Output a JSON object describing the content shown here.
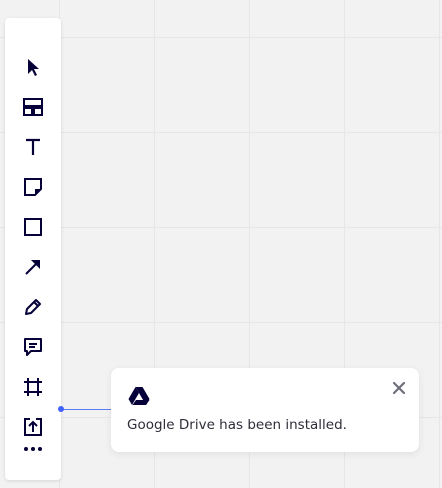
{
  "toolbar": {
    "tools": [
      {
        "name": "select",
        "icon": "cursor-icon"
      },
      {
        "name": "templates",
        "icon": "templates-icon"
      },
      {
        "name": "text",
        "icon": "text-icon"
      },
      {
        "name": "sticky-note",
        "icon": "sticky-note-icon"
      },
      {
        "name": "shape",
        "icon": "square-icon"
      },
      {
        "name": "connection-line",
        "icon": "arrow-icon"
      },
      {
        "name": "pen",
        "icon": "pencil-icon"
      },
      {
        "name": "comment",
        "icon": "comment-icon"
      },
      {
        "name": "frame",
        "icon": "frame-icon"
      },
      {
        "name": "upload",
        "icon": "upload-icon"
      },
      {
        "name": "more",
        "icon": "more-icon"
      }
    ],
    "icon_color": "#050038"
  },
  "notification": {
    "logo_icon": "google-drive-icon",
    "message": "Google Drive has been installed.",
    "close_icon": "close-icon"
  },
  "colors": {
    "canvas": "#f2f2f2",
    "accent": "#4262ff"
  }
}
